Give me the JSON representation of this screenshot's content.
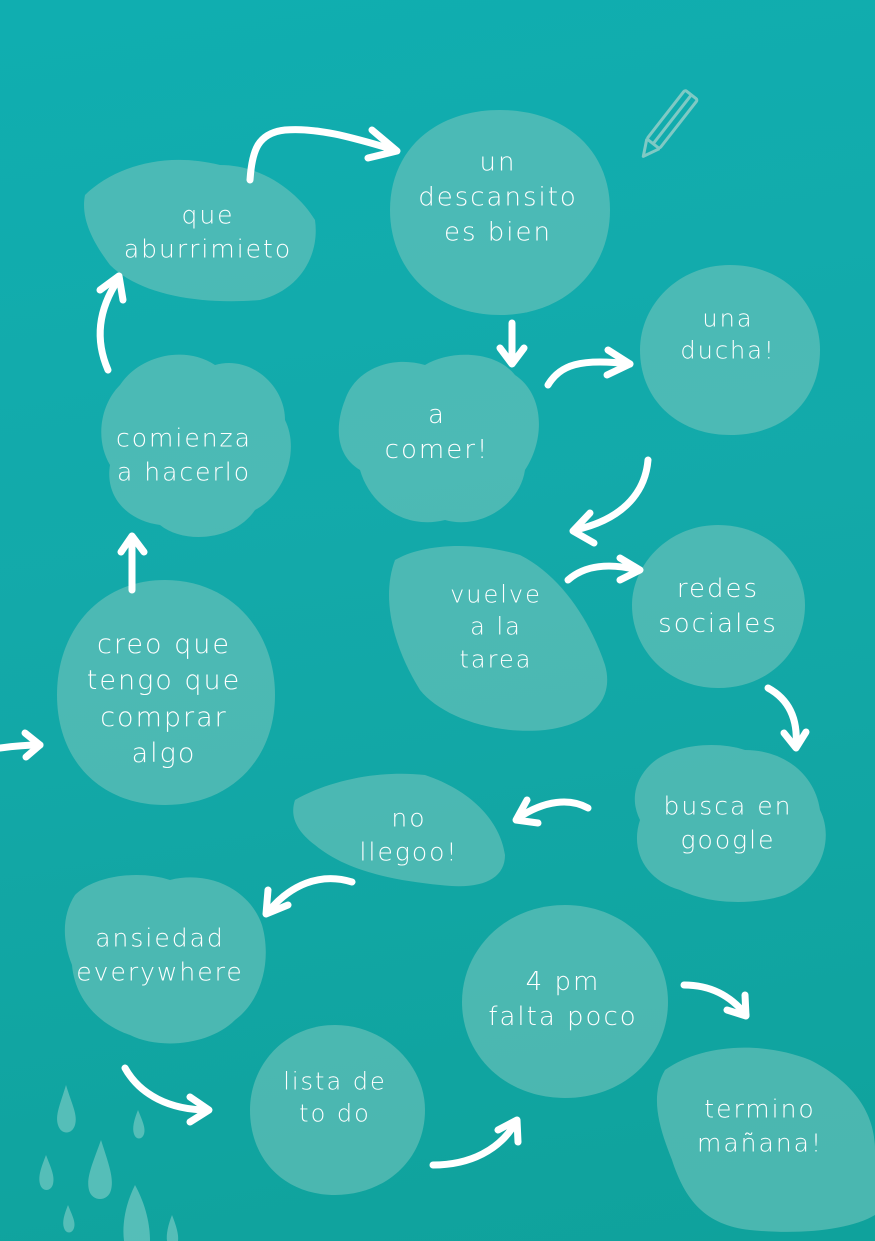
{
  "bubbles": {
    "que_aburrimiento": "que\naburrimieto",
    "descansito": "un\ndescansito\nes bien",
    "ducha": "una\nducha!",
    "comer": "a\ncomer!",
    "comienza": "comienza\na hacerlo",
    "vuelve": "vuelve\na la\ntarea",
    "redes": "redes\nsociales",
    "creo": "creo que\ntengo que\ncomprar\nalgo",
    "busca": "busca en\ngoogle",
    "no_llego": "no\nllegoo!",
    "ansiedad": "ansiedad\neverywhere",
    "cuatro_pm": "4 pm\nfalta poco",
    "lista": "lista de\nto do",
    "termino": "termino\nmañana!"
  },
  "colors": {
    "background": "#13a9a9",
    "bubble": "#6fc3bb",
    "text": "#ffffff"
  },
  "icons": [
    "pencil-icon",
    "raindrop-icon"
  ]
}
